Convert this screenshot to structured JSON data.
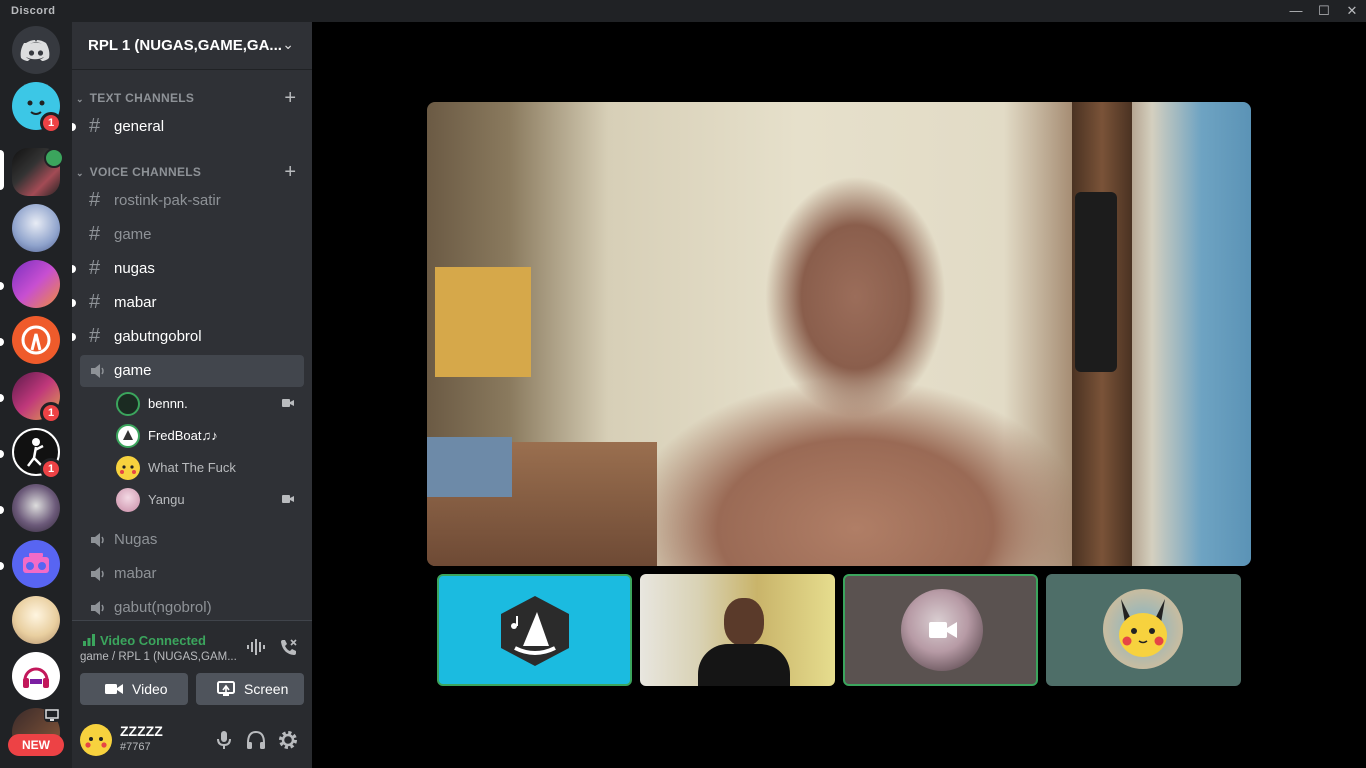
{
  "app": {
    "title": "Discord"
  },
  "window": {
    "minimize": "—",
    "maximize": "☐",
    "close": "✕"
  },
  "servers": {
    "badges": [
      "1",
      "1",
      "1"
    ],
    "new_label": "NEW"
  },
  "sidebar": {
    "server_name": "RPL 1 (NUGAS,GAME,GA...",
    "categories": {
      "text": "TEXT CHANNELS",
      "voice": "VOICE CHANNELS"
    },
    "text_channels": [
      {
        "name": "general"
      }
    ],
    "voice_channels": [
      {
        "name": "rostink-pak-satir"
      },
      {
        "name": "game"
      },
      {
        "name": "nugas"
      },
      {
        "name": "mabar"
      },
      {
        "name": "gabutngobrol"
      },
      {
        "name": "game"
      },
      {
        "name": "Nugas"
      },
      {
        "name": "mabar"
      },
      {
        "name": "gabut(ngobrol)"
      }
    ],
    "voice_users": [
      {
        "name": "bennn."
      },
      {
        "name": "FredBoat♫♪"
      },
      {
        "name": "What The Fuck"
      },
      {
        "name": "Yangu"
      }
    ]
  },
  "voice_panel": {
    "status": "Video Connected",
    "subtitle": "game / RPL 1 (NUGAS,GAM...",
    "video_label": "Video",
    "screen_label": "Screen"
  },
  "user": {
    "name": "ZZZZZ",
    "tag": "#7767"
  },
  "colors": {
    "accent_green": "#3ba55d",
    "badge_red": "#ed4245",
    "blurple": "#5865f2",
    "fredboat_tile": "#1bbbe0",
    "pikachu_tile": "#4e6e68"
  }
}
